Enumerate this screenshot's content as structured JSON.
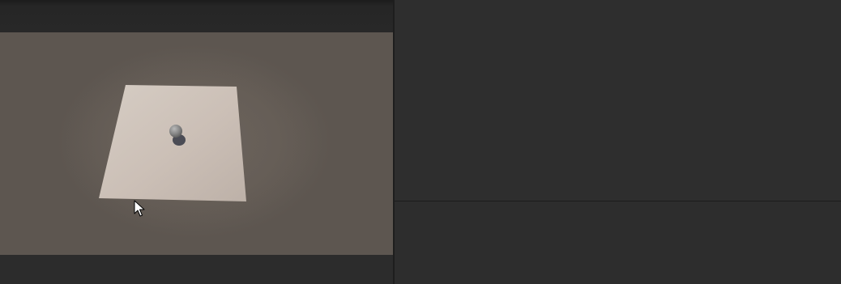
{
  "app": {
    "title": ""
  },
  "scene": {
    "objects": [
      "plane",
      "sphere"
    ],
    "colors": {
      "background": "#655d56",
      "plane": "#cfc4ba",
      "sphere": "#8a8a8a",
      "shadow": "#3d3f4a"
    }
  },
  "panels": {
    "right_top": "",
    "right_bottom": ""
  },
  "icons": {
    "cursor": "arrow-pointer-icon"
  }
}
